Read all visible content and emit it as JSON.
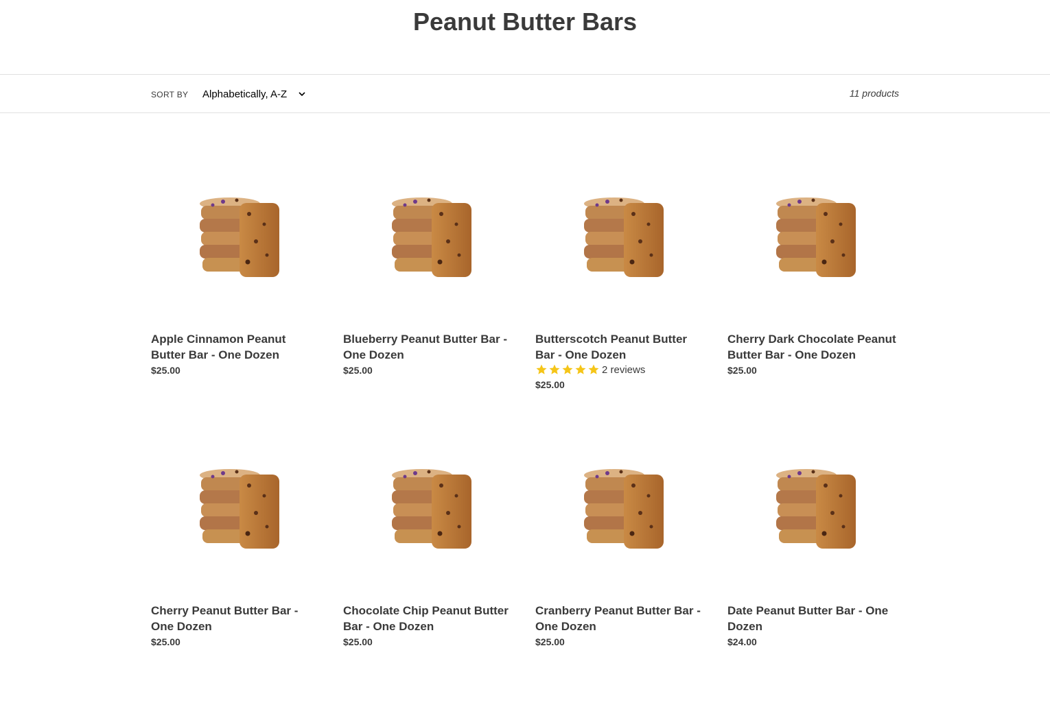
{
  "page": {
    "title": "Peanut Butter Bars"
  },
  "filters": {
    "sort_label": "SORT BY",
    "sort_value": "Alphabetically, A-Z",
    "product_count": "11 products"
  },
  "colors": {
    "text": "#3a3a3a",
    "star": "#f5c518",
    "divider": "#e0e0e0"
  },
  "products": [
    {
      "title": "Apple Cinnamon Peanut Butter Bar - One Dozen",
      "price": "$25.00",
      "image_icon": "peanut-butter-bar-stack-image"
    },
    {
      "title": "Blueberry Peanut Butter Bar - One Dozen",
      "price": "$25.00",
      "image_icon": "peanut-butter-bar-stack-image"
    },
    {
      "title": "Butterscotch Peanut Butter Bar - One Dozen",
      "price": "$25.00",
      "rating": 5,
      "reviews": "2 reviews",
      "image_icon": "peanut-butter-bar-stack-image"
    },
    {
      "title": "Cherry Dark Chocolate Peanut Butter Bar - One Dozen",
      "price": "$25.00",
      "image_icon": "peanut-butter-bar-stack-image"
    },
    {
      "title": "Cherry Peanut Butter Bar - One Dozen",
      "price": "$25.00",
      "image_icon": "peanut-butter-bar-stack-image"
    },
    {
      "title": "Chocolate Chip Peanut Butter Bar - One Dozen",
      "price": "$25.00",
      "image_icon": "peanut-butter-bar-stack-image"
    },
    {
      "title": "Cranberry Peanut Butter Bar - One Dozen",
      "price": "$25.00",
      "image_icon": "peanut-butter-bar-stack-image"
    },
    {
      "title": "Date Peanut Butter Bar - One Dozen",
      "price": "$24.00",
      "image_icon": "peanut-butter-bar-stack-image"
    }
  ]
}
